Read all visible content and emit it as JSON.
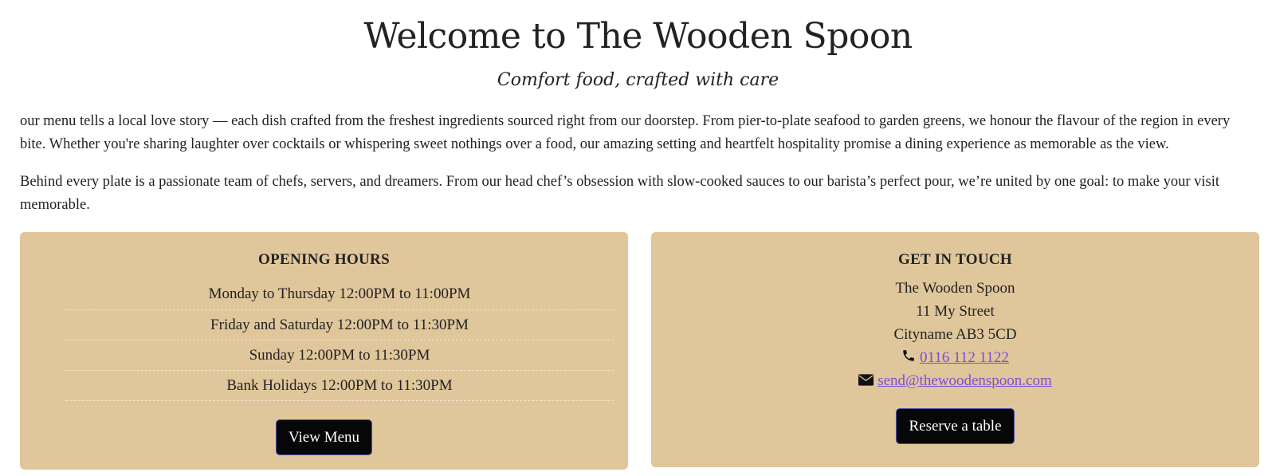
{
  "header": {
    "title": "Welcome to The Wooden Spoon",
    "tagline": "Comfort food, crafted with care"
  },
  "intro": {
    "paragraph1": "our menu tells a local love story — each dish crafted from the freshest ingredients sourced right from our doorstep. From pier-to-plate seafood to garden greens, we honour the flavour of the region in every bite. Whether you're sharing laughter over cocktails or whispering sweet nothings over a food, our amazing setting and heartfelt hospitality promise a dining experience as memorable as the view.",
    "paragraph2": "Behind every plate is a passionate team of chefs, servers, and dreamers. From our head chef’s obsession with slow-cooked sauces to our barista’s perfect pour, we’re united by one goal: to make your visit memorable."
  },
  "opening_hours": {
    "title": "OPENING HOURS",
    "rows": [
      "Monday to Thursday 12:00PM to 11:00PM",
      "Friday and Saturday 12:00PM to 11:30PM",
      "Sunday 12:00PM to 11:30PM",
      "Bank Holidays 12:00PM to 11:30PM"
    ],
    "button_label": "View Menu"
  },
  "contact": {
    "title": "GET IN TOUCH",
    "name": "The Wooden Spoon",
    "street": "11 My Street",
    "city": "Cityname AB3 5CD",
    "phone": "0116 112 1122",
    "email": "send@thewoodenspoon.com",
    "phone_icon": "phone-icon",
    "email_icon": "envelope-icon",
    "button_label": "Reserve a table"
  },
  "colors": {
    "card_background": "#dfc69b",
    "button_background": "#070707",
    "link": "#7b4fd6",
    "text": "#222222"
  }
}
